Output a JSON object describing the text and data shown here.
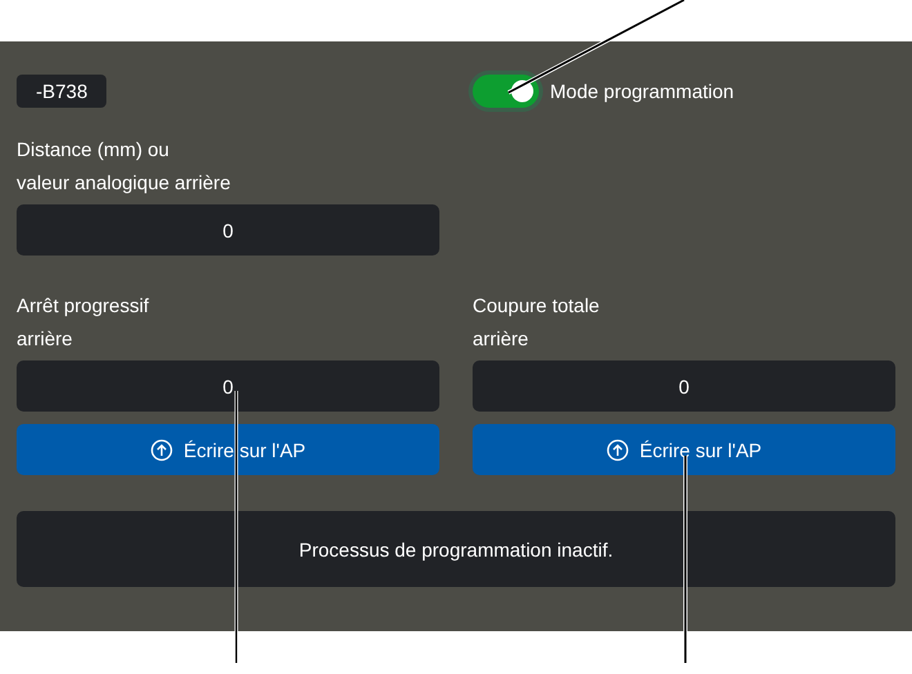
{
  "tag": "-B738",
  "mode_toggle": {
    "label": "Mode programmation",
    "on": true
  },
  "distance_field": {
    "label_lines": [
      "Distance (mm) ou",
      "valeur analogique arrière"
    ],
    "value": "0"
  },
  "stop_fields": [
    {
      "label_lines": [
        "Arrêt progressif",
        "arrière"
      ],
      "value": "0",
      "button": "Écrire sur l'AP"
    },
    {
      "label_lines": [
        "Coupure totale",
        "arrière"
      ],
      "value": "0",
      "button": "Écrire sur l'AP"
    }
  ],
  "status": "Processus de programmation inactif."
}
